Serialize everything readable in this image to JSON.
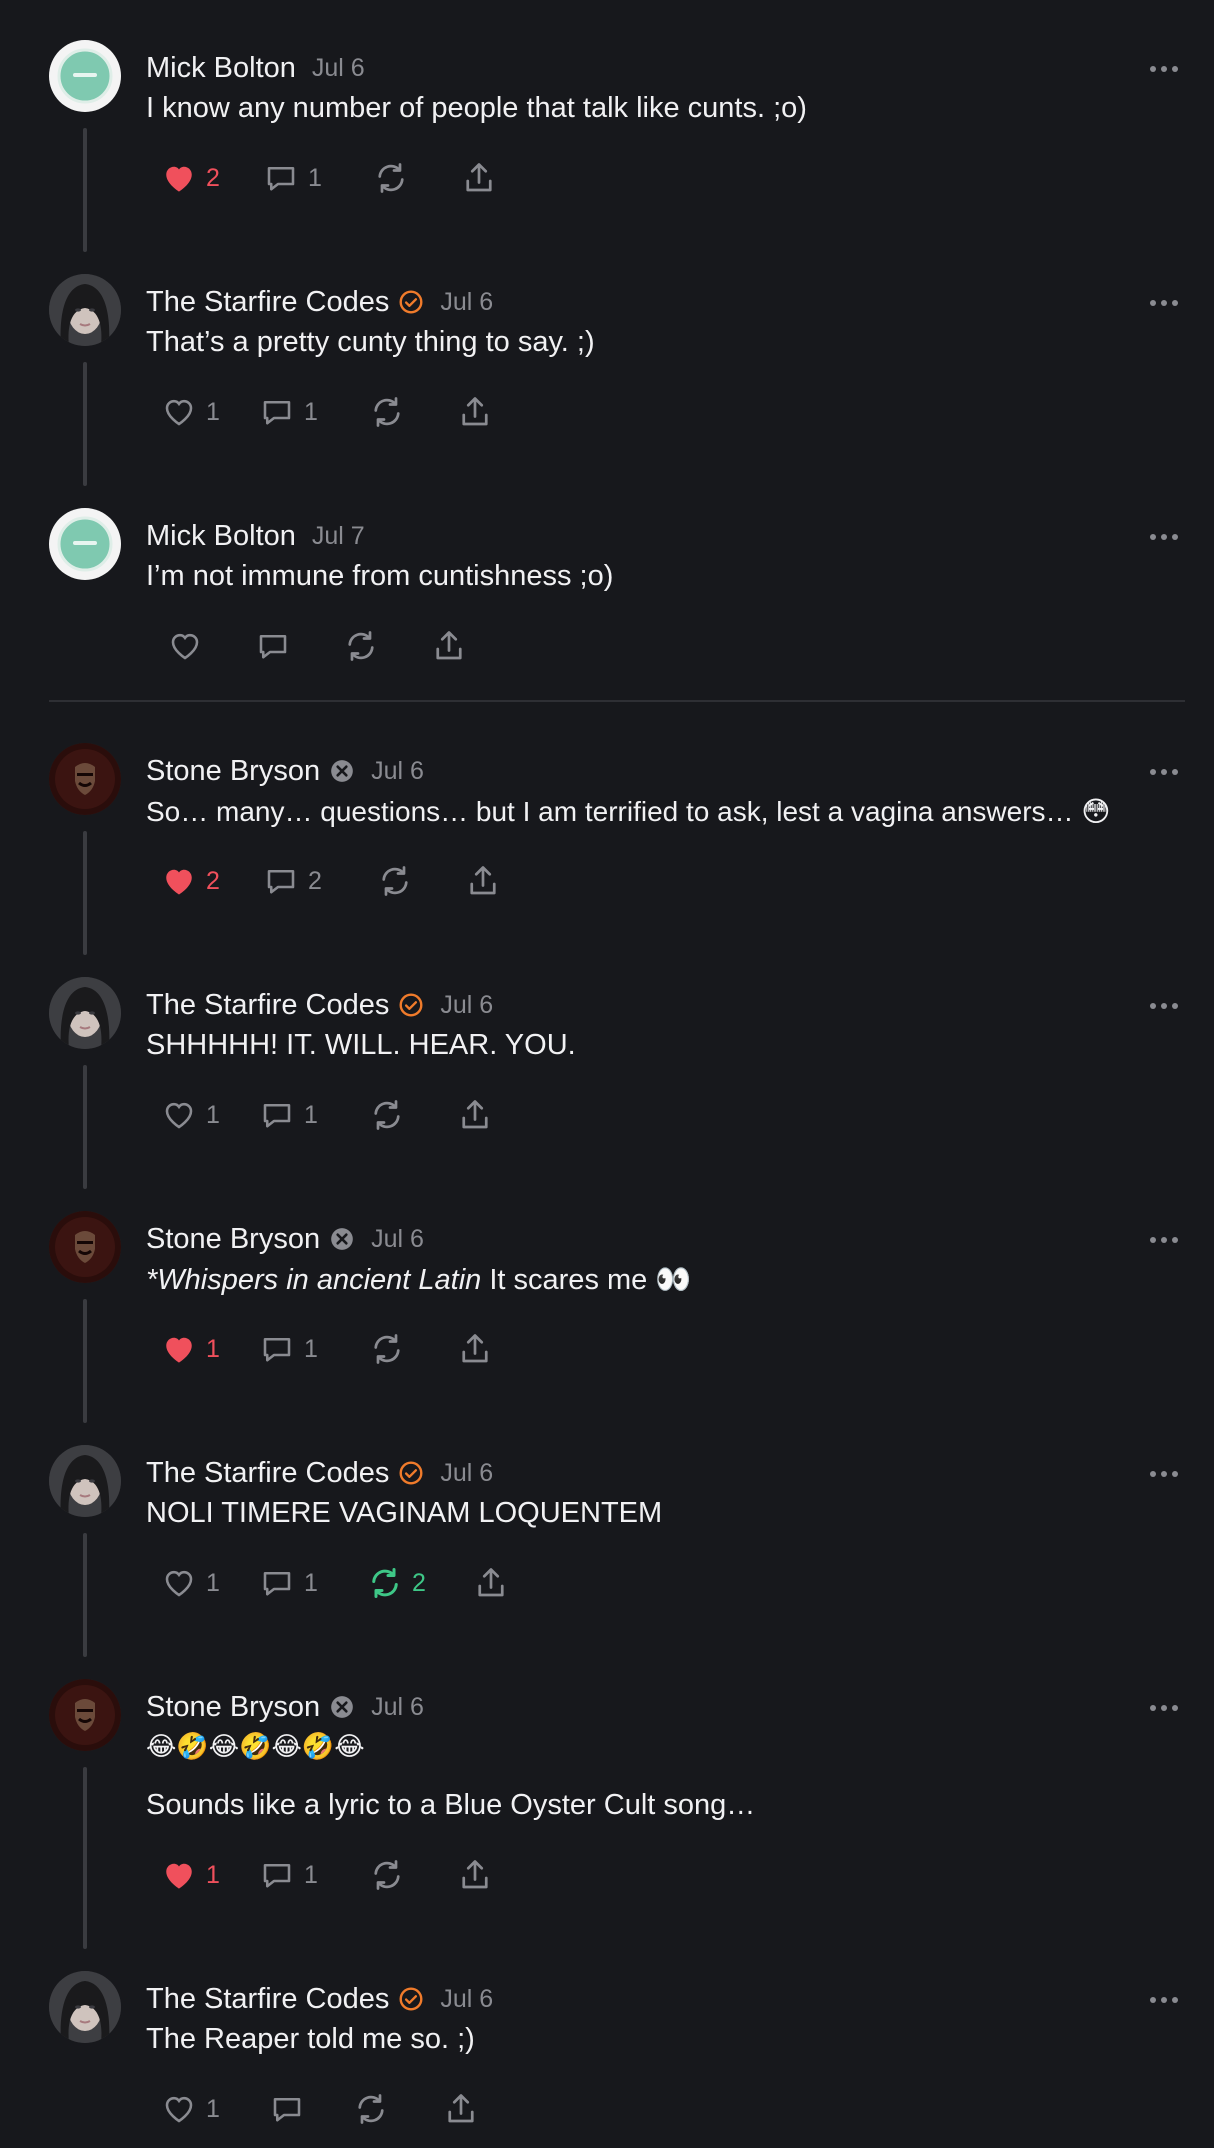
{
  "colors": {
    "background": "#17181c",
    "text": "#f1f1f3",
    "muted": "#8a8b91",
    "like_active": "#f0505c",
    "repost_active": "#3ec787",
    "verified_orange": "#f07b2b",
    "thread_line": "#3a3b40"
  },
  "posts": [
    {
      "author": "Mick Bolton",
      "date": "Jul 6",
      "badge": "",
      "avatar_icon": "profile-avatar-icon",
      "text": "I know any number of people that talk like cunts. ;o)",
      "likes": "2",
      "liked": true,
      "replies": "1",
      "reposts": "",
      "reposted": false
    },
    {
      "author": "The Starfire Codes",
      "date": "Jul 6",
      "badge": "verified-icon",
      "avatar_icon": "profile-avatar-icon",
      "text": "That’s a pretty cunty thing to say. ;)",
      "likes": "1",
      "liked": false,
      "replies": "1",
      "reposts": "",
      "reposted": false
    },
    {
      "author": "Mick Bolton",
      "date": "Jul 7",
      "badge": "",
      "avatar_icon": "profile-avatar-icon",
      "text": "I’m not immune from cuntishness ;o)",
      "likes": "",
      "liked": false,
      "replies": "",
      "reposts": "",
      "reposted": false
    },
    {
      "author": "Stone Bryson",
      "date": "Jul 6",
      "badge": "muted-badge-icon",
      "avatar_icon": "profile-avatar-icon",
      "text": "So… many… questions… but I am terrified to ask, lest a vagina answers… 😳",
      "likes": "2",
      "liked": true,
      "replies": "2",
      "reposts": "",
      "reposted": false
    },
    {
      "author": "The Starfire Codes",
      "date": "Jul 6",
      "badge": "verified-icon",
      "avatar_icon": "profile-avatar-icon",
      "text": "SHHHHH! IT. WILL. HEAR. YOU.",
      "likes": "1",
      "liked": false,
      "replies": "1",
      "reposts": "",
      "reposted": false
    },
    {
      "author": "Stone Bryson",
      "date": "Jul 6",
      "badge": "muted-badge-icon",
      "avatar_icon": "profile-avatar-icon",
      "text_italic": "*Whispers in ancient Latin",
      "text": " It scares me 👀",
      "likes": "1",
      "liked": true,
      "replies": "1",
      "reposts": "",
      "reposted": false
    },
    {
      "author": "The Starfire Codes",
      "date": "Jul 6",
      "badge": "verified-icon",
      "avatar_icon": "profile-avatar-icon",
      "text": "NOLI TIMERE VAGINAM LOQUENTEM",
      "likes": "1",
      "liked": false,
      "replies": "1",
      "reposts": "2",
      "reposted": true
    },
    {
      "author": "Stone Bryson",
      "date": "Jul 6",
      "badge": "muted-badge-icon",
      "avatar_icon": "profile-avatar-icon",
      "text": "😂🤣😂🤣😂🤣😂",
      "text2": "Sounds like a lyric to a Blue Oyster Cult song…",
      "likes": "1",
      "liked": true,
      "replies": "1",
      "reposts": "",
      "reposted": false
    },
    {
      "author": "The Starfire Codes",
      "date": "Jul 6",
      "badge": "verified-icon",
      "avatar_icon": "profile-avatar-icon",
      "text": "The Reaper told me so. ;)",
      "likes": "1",
      "liked": false,
      "replies": "",
      "reposts": "",
      "reposted": false
    }
  ],
  "icons": {
    "like": "heart-icon",
    "reply": "speech-bubble-icon",
    "repost": "repost-arrows-icon",
    "share": "share-upload-icon",
    "more": "more-dots-icon"
  }
}
